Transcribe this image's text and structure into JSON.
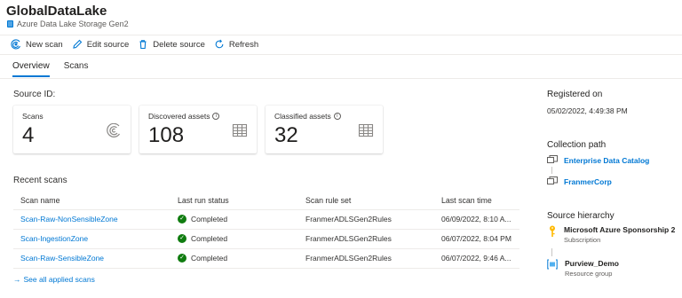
{
  "header": {
    "title": "GlobalDataLake",
    "subtitle": "Azure Data Lake Storage Gen2"
  },
  "toolbar": {
    "new_scan": "New scan",
    "edit_source": "Edit source",
    "delete_source": "Delete source",
    "refresh": "Refresh"
  },
  "tabs": [
    {
      "label": "Overview",
      "active": true
    },
    {
      "label": "Scans",
      "active": false
    }
  ],
  "source_id_label": "Source ID:",
  "cards": [
    {
      "label": "Scans",
      "value": "4",
      "icon": "scan-icon"
    },
    {
      "label": "Discovered assets",
      "value": "108",
      "icon": "table-icon"
    },
    {
      "label": "Classified assets",
      "value": "32",
      "icon": "table-icon"
    }
  ],
  "recent_scans": {
    "title": "Recent scans",
    "columns": [
      "Scan name",
      "Last run status",
      "Scan rule set",
      "Last scan time"
    ],
    "rows": [
      {
        "name": "Scan-Raw-NonSensibleZone",
        "status": "Completed",
        "rule_set": "FranmerADLSGen2Rules",
        "time": "06/09/2022, 8:10 A..."
      },
      {
        "name": "Scan-IngestionZone",
        "status": "Completed",
        "rule_set": "FranmerADLSGen2Rules",
        "time": "06/07/2022, 8:04 PM"
      },
      {
        "name": "Scan-Raw-SensibleZone",
        "status": "Completed",
        "rule_set": "FranmerADLSGen2Rules",
        "time": "06/07/2022, 9:46 A..."
      }
    ],
    "see_all": "See all applied scans"
  },
  "right_panel": {
    "registered_on_label": "Registered on",
    "registered_on_value": "05/02/2022, 4:49:38 PM",
    "collection_path_label": "Collection path",
    "collection_path": [
      "Enterprise Data Catalog",
      "FranmerCorp"
    ],
    "source_hierarchy_label": "Source hierarchy",
    "hierarchy": [
      {
        "name": "Microsoft Azure Sponsorship 2",
        "type": "Subscription",
        "icon": "key-icon"
      },
      {
        "name": "Purview_Demo",
        "type": "Resource group",
        "icon": "resource-group-icon"
      }
    ]
  },
  "colors": {
    "accent": "#0078d4",
    "success": "#107c10",
    "key": "#ffb900"
  }
}
